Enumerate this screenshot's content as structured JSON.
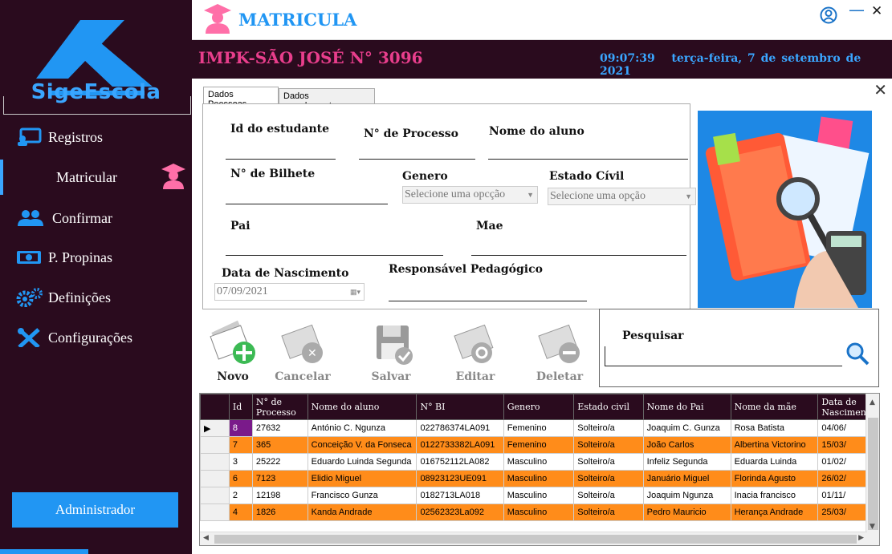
{
  "sidebar": {
    "brand": "SigeEscola",
    "items": [
      {
        "label": "Registros",
        "icon": "monitor-user-icon"
      },
      {
        "label": "Matricular",
        "icon": "graduate-icon"
      },
      {
        "label": "Confirmar",
        "icon": "users-icon"
      },
      {
        "label": "P. Propinas",
        "icon": "money-icon"
      },
      {
        "label": "Definições",
        "icon": "gears-icon"
      },
      {
        "label": "Configurações",
        "icon": "tools-icon"
      }
    ],
    "admin_label": "Administrador"
  },
  "header": {
    "title": "MATRICULA",
    "minimize": "—",
    "close": "✕"
  },
  "banner": {
    "school": "IMPK-SÃO JOSÉ N° 3096",
    "time": "09:07:39",
    "date": "terça-feira, 7 de setembro de 2021"
  },
  "tabs": [
    {
      "label": "Dados Peessoas"
    },
    {
      "label": "Dados complementares"
    }
  ],
  "form": {
    "id_label": "Id do estudante",
    "processo_label": "N° de Processo",
    "nome_label": "Nome do aluno",
    "bilhete_label": "N° de Bilhete",
    "genero_label": "Genero",
    "genero_value": "Selecione uma opcção",
    "estado_label": "Estado Cívil",
    "estado_value": "Selecione uma opção",
    "pai_label": "Pai",
    "mae_label": "Mae",
    "nascimento_label": "Data de Nascimento",
    "nascimento_value": "07/09/2021",
    "responsavel_label": "Responsável  Pedagógico"
  },
  "toolbar": {
    "novo": "Novo",
    "cancelar": "Cancelar",
    "salvar": "Salvar",
    "editar": "Editar",
    "deletar": "Deletar"
  },
  "search": {
    "label": "Pesquisar"
  },
  "grid": {
    "columns": [
      "Id",
      "N° de Processo",
      "Nome do aluno",
      "N° BI",
      "Genero",
      "Estado civil",
      "Nome do Pai",
      "Nome da mãe",
      "Data de Nascimento"
    ],
    "rows": [
      [
        "8",
        "27632",
        "António C. Ngunza",
        "022786374LA091",
        "Femenino",
        "Solteiro/a",
        "Joaquim C. Gunza",
        "Rosa Batista",
        "04/06/"
      ],
      [
        "7",
        "365",
        "Conceição V. da Fonseca",
        "0122733382LA091",
        "Femenino",
        "Solteiro/a",
        "João Carlos",
        "Albertina Victorino",
        "15/03/"
      ],
      [
        "3",
        "25222",
        "Eduardo Luinda Segunda",
        "016752112LA082",
        "Masculino",
        "Solteiro/a",
        "Infeliz Segunda",
        "Eduarda Luinda",
        "01/02/"
      ],
      [
        "6",
        "7123",
        "Elidio Miguel",
        "08923123UE091",
        "Masculino",
        "Solteiro/a",
        "Januário Miguel",
        "Florinda Agusto",
        "26/02/"
      ],
      [
        "2",
        "12198",
        "Francisco Gunza",
        "0182713LA018",
        "Masculino",
        "Solteiro/a",
        "Joaquim Ngunza",
        "Inacia francisco",
        "01/11/"
      ],
      [
        "4",
        "1826",
        "Kanda Andrade",
        "02562323La092",
        "Masculino",
        "Solteiro/a",
        "Pedro Mauricio",
        "Herança Andrade",
        "25/03/"
      ]
    ]
  },
  "colors": {
    "sidebar": "#2a0b1e",
    "accent": "#2196f3",
    "pink": "#e83e8c",
    "highlight": "#ff8c1a"
  }
}
